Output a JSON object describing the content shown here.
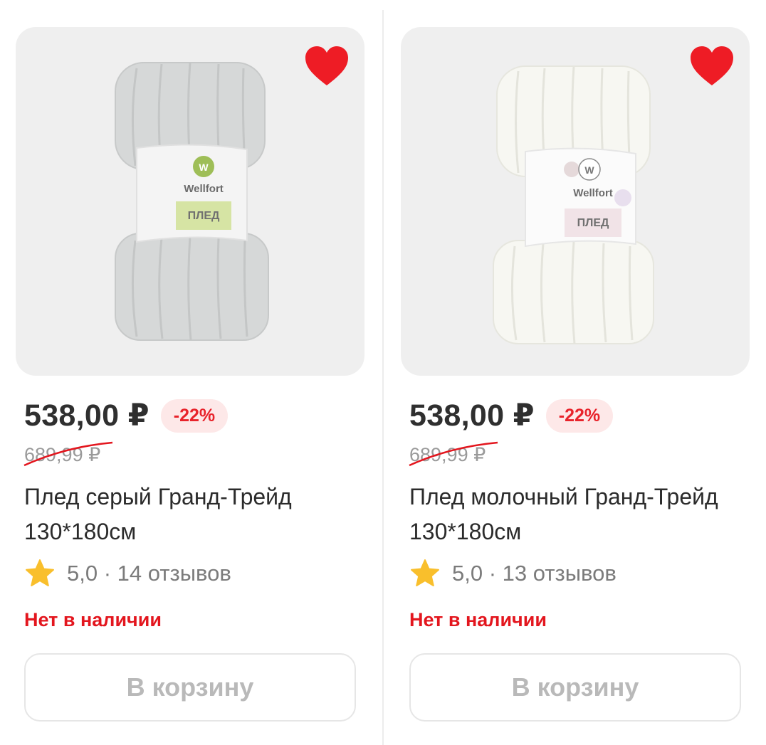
{
  "products": [
    {
      "price": "538,00 ₽",
      "discount": "-22%",
      "old_price": "689,99 ₽",
      "title": "Плед серый Гранд-Трейд 130*180см",
      "rating": "5,0",
      "reviews": "14 отзывов",
      "stock": "Нет в наличии",
      "cart_label": "В корзину",
      "image": {
        "brand": "Wellfort",
        "logo_letter": "W",
        "label": "ПЛЕД",
        "color": "#d7d9d9",
        "label_bg": "#d6e4a4"
      },
      "favorite": true
    },
    {
      "price": "538,00 ₽",
      "discount": "-22%",
      "old_price": "689,99 ₽",
      "title": "Плед молочный Гранд-Трейд 130*180см",
      "rating": "5,0",
      "reviews": "13 отзывов",
      "stock": "Нет в наличии",
      "cart_label": "В корзину",
      "image": {
        "brand": "Wellfort",
        "logo_letter": "W",
        "label": "ПЛЕД",
        "color": "#f6f6f1",
        "label_bg": "#f1e3e7"
      },
      "favorite": true
    }
  ],
  "colors": {
    "accent_red": "#e3161e",
    "heart_red": "#ee1c25",
    "discount_bg": "#fde8e8",
    "star": "#f9bf2c"
  }
}
